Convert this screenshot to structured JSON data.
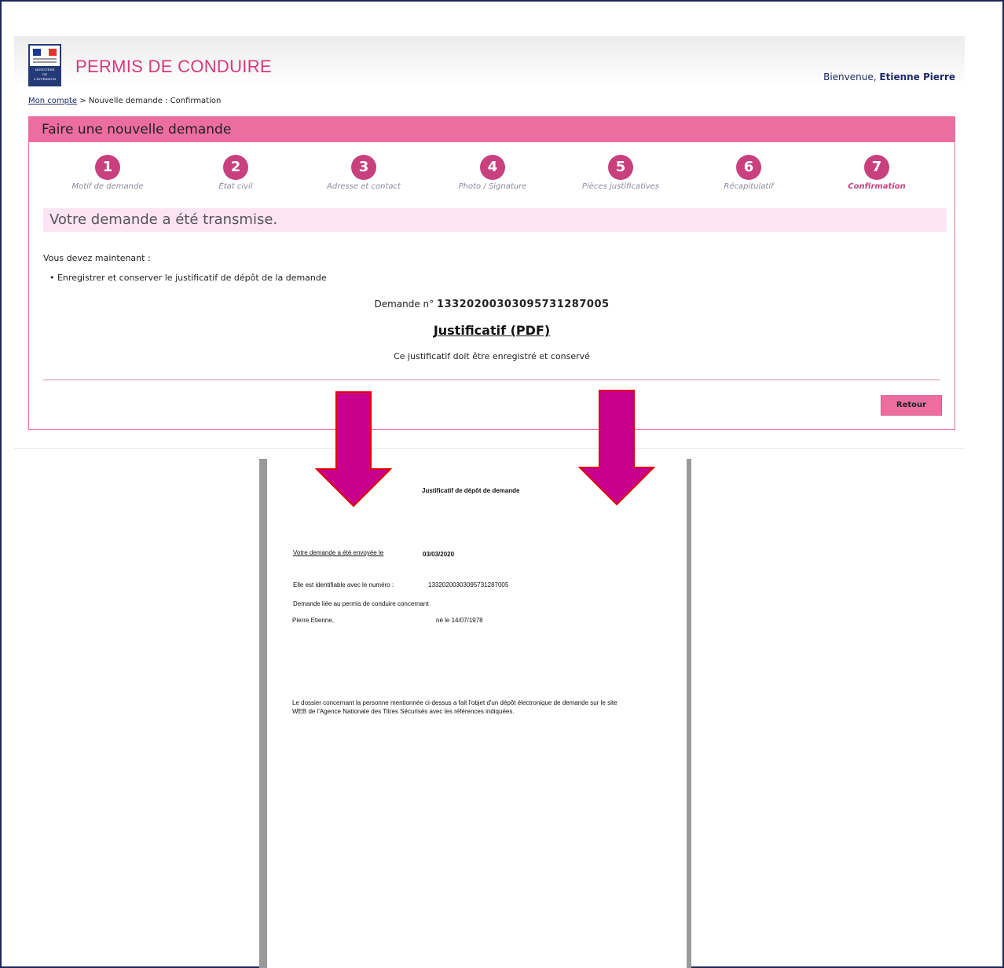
{
  "header": {
    "logo_lines": [
      "MINISTÈRE",
      "DE",
      "L'INTÉRIEUR"
    ],
    "app_title": "PERMIS DE CONDUIRE",
    "welcome_prefix": "Bienvenue,",
    "user_name": "Etienne Pierre"
  },
  "breadcrumb": {
    "home_link": "Mon compte",
    "separator": ">",
    "current": "Nouvelle demande : Confirmation"
  },
  "panel": {
    "title": "Faire une nouvelle demande",
    "steps": [
      {
        "num": "1",
        "label": "Motif de demande"
      },
      {
        "num": "2",
        "label": "État civil"
      },
      {
        "num": "3",
        "label": "Adresse et contact"
      },
      {
        "num": "4",
        "label": "Photo / Signature"
      },
      {
        "num": "5",
        "label": "Pièces justificatives"
      },
      {
        "num": "6",
        "label": "Récapitulatif"
      },
      {
        "num": "7",
        "label": "Confirmation"
      }
    ],
    "active_step": 7,
    "banner": "Votre demande a été transmise.",
    "instruction_title": "Vous devez maintenant :",
    "instruction_item": "• Enregistrer et conserver le justificatif de dépôt de la demande",
    "demande_prefix": "Demande n°",
    "demande_number": "13320200303095731287005",
    "pdf_link": "Justificatif (PDF)",
    "keep_note": "Ce justificatif doit être enregistré et conservé",
    "retour_button": "Retour"
  },
  "document": {
    "title": "Justificatif de dépôt de demande",
    "sent_label": "Votre demande a été envoyée le",
    "sent_date": "03/03/2020",
    "id_label": "Elle est identifiable avec le numéro :",
    "id_value": "13320200303095731287005",
    "linked_label": "Demande liée au permis de conduire concernant",
    "person_name": "Pierre Etienne,",
    "birth": "né le 14/07/1978",
    "footer_text_1": "Le dossier concernant la personne mentionnée ci-dessus a fait l'objet d'un dépôt électronique de demande sur le site",
    "footer_text_2": "WEB de l'Agence Nationale des Titres Sécurisés avec les références indiquées."
  },
  "colors": {
    "brand_pink": "#ec6ea0",
    "step_circle": "#c8407e",
    "banner_bg": "#fde4f4",
    "arrow_fill": "#c8008c",
    "arrow_stroke": "#e00000",
    "title_color": "#d43a7a"
  }
}
